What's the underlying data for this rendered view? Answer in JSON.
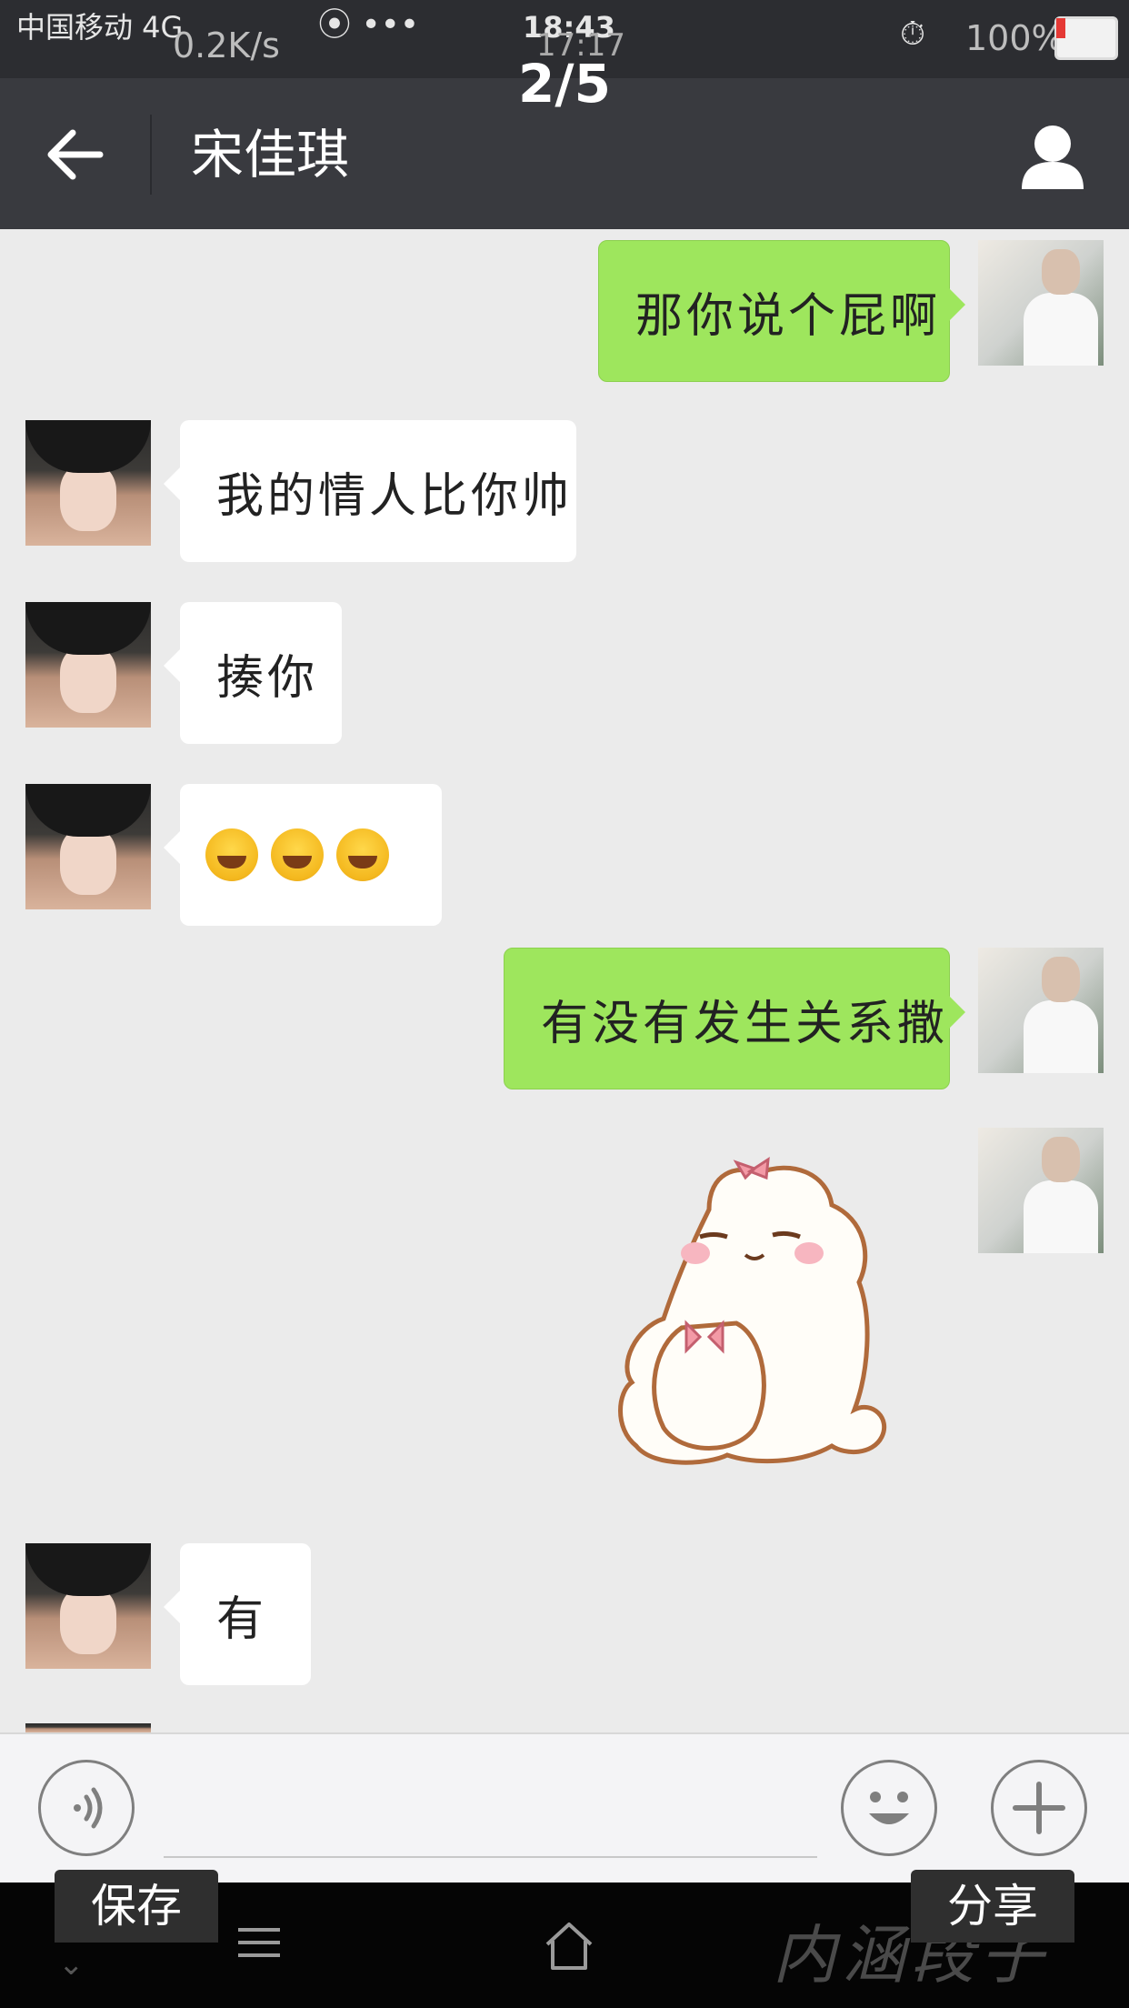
{
  "status_bar": {
    "carrier": "中国移动 4G",
    "speed": "0.2K/s",
    "time": "18:43",
    "time_secondary": "17:17",
    "dots": "⦿ •••",
    "battery": "100%"
  },
  "viewer": {
    "counter": "2/5",
    "save_label": "保存",
    "share_label": "分享",
    "watermark": "内涵段子"
  },
  "navbar": {
    "title": "宋佳琪"
  },
  "messages": [
    {
      "sender": "me",
      "text": "那你说个屁啊"
    },
    {
      "sender": "other",
      "text": "我的情人比你帅"
    },
    {
      "sender": "other",
      "text": "揍你"
    },
    {
      "sender": "other",
      "emoji": [
        "grin-emoji",
        "grin-emoji",
        "grin-emoji"
      ]
    },
    {
      "sender": "me",
      "text": "有没有发生关系撒"
    },
    {
      "sender": "me",
      "sticker": "cat-sticker"
    },
    {
      "sender": "other",
      "text": "有"
    }
  ],
  "input": {
    "value": ""
  }
}
